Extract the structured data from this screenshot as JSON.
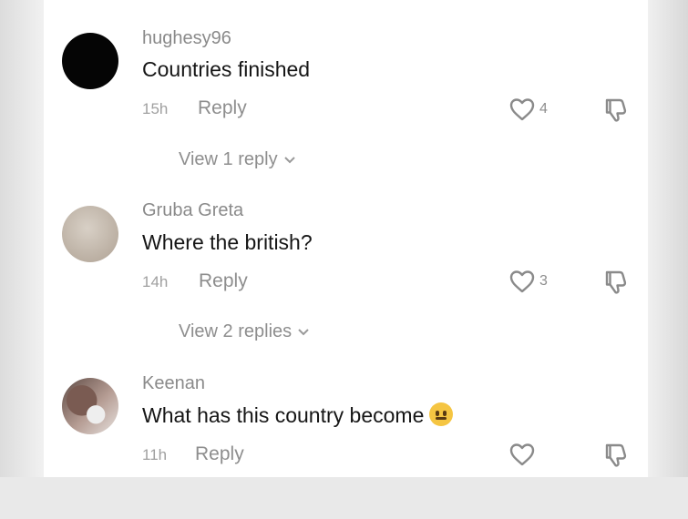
{
  "comments": [
    {
      "username": "hughesy96",
      "text": "Countries finished",
      "time": "15h",
      "reply_label": "Reply",
      "likes": "4",
      "view_replies": "View 1 reply"
    },
    {
      "username": "Gruba Greta",
      "text": "Where the british?",
      "time": "14h",
      "reply_label": "Reply",
      "likes": "3",
      "view_replies": "View 2 replies"
    },
    {
      "username": "Keenan",
      "text": "What has this country become",
      "time": "11h",
      "reply_label": "Reply",
      "likes": ""
    }
  ],
  "colors": {
    "text_primary": "#161616",
    "text_secondary": "#8e8e8e",
    "background": "#ffffff"
  },
  "icons": {
    "like": "heart-outline-icon",
    "dislike": "thumbs-down-outline-icon",
    "expand": "chevron-down-icon",
    "emoji": "neutral-face-emoji"
  }
}
